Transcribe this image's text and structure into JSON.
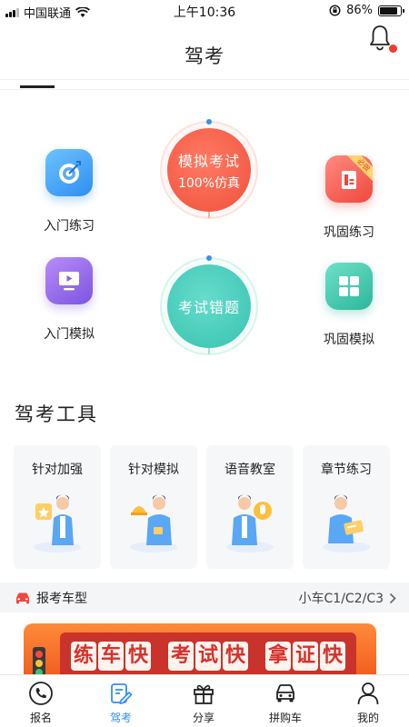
{
  "status_bar": {
    "carrier": "中国联通",
    "time": "上午10:36",
    "battery": "86%",
    "battery_level": 0.86
  },
  "nav": {
    "title": "驾考"
  },
  "practice": {
    "intro_practice": "入门练习",
    "intro_mock": "入门模拟",
    "review_practice": "巩固练习",
    "review_practice_badge": "必做",
    "review_mock": "巩固模拟",
    "mock_exam": {
      "title": "模拟考试",
      "subtitle": "100%仿真"
    },
    "wrong_questions": {
      "title": "考试错题"
    }
  },
  "tools": {
    "title": "驾考工具",
    "cards": [
      {
        "label": "针对加强"
      },
      {
        "label": "针对模拟"
      },
      {
        "label": "语音教室"
      },
      {
        "label": "章节练习"
      }
    ]
  },
  "vehicle": {
    "label": "报考车型",
    "value": "小车C1/C2/C3"
  },
  "banner": {
    "chars": [
      "练",
      "车",
      "快",
      "考",
      "试",
      "快",
      "拿",
      "证",
      "快"
    ]
  },
  "tab_bar": {
    "items": [
      {
        "label": "报名",
        "icon": "phone-icon"
      },
      {
        "label": "驾考",
        "icon": "edit-note-icon"
      },
      {
        "label": "分享",
        "icon": "gift-icon"
      },
      {
        "label": "拼购车",
        "icon": "car-icon"
      },
      {
        "label": "我的",
        "icon": "person-icon"
      }
    ],
    "active_index": 1,
    "active_color": "#2f8ef0"
  },
  "colors": {
    "accent_blue": "#2f8ef0",
    "mock_red": "#f0513d",
    "wrong_teal": "#38c2b0",
    "banner_orange": "#f25c1e"
  }
}
